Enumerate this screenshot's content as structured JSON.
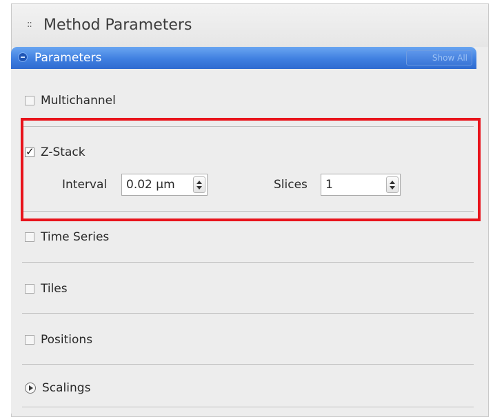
{
  "panel": {
    "title": "Method Parameters",
    "grip": "::"
  },
  "parameters_bar": {
    "label": "Parameters",
    "show_all_label": "Show All"
  },
  "options": {
    "multichannel": {
      "label": "Multichannel",
      "checked": false
    },
    "zstack": {
      "label": "Z-Stack",
      "checked": true,
      "interval_label": "Interval",
      "interval_value": "0.02 µm",
      "slices_label": "Slices",
      "slices_value": "1"
    },
    "time_series": {
      "label": "Time Series",
      "checked": false
    },
    "tiles": {
      "label": "Tiles",
      "checked": false
    },
    "positions": {
      "label": "Positions",
      "checked": false
    },
    "scalings": {
      "label": "Scalings",
      "expanded": false
    }
  },
  "colors": {
    "highlight": "#e8131b",
    "bar_blue": "#3f7fe0"
  }
}
